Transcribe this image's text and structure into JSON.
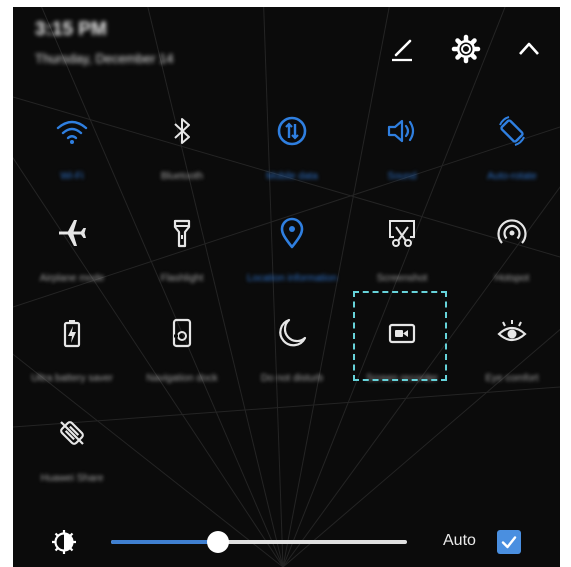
{
  "header": {
    "time": "3:15 PM",
    "date": "Thursday, December 14"
  },
  "tiles": [
    {
      "label": "Wi-Fi",
      "icon": "wifi-icon",
      "active": true
    },
    {
      "label": "Bluetooth",
      "icon": "bluetooth-icon",
      "active": false
    },
    {
      "label": "Mobile data",
      "icon": "mobile-data-icon",
      "active": true
    },
    {
      "label": "Sound",
      "icon": "sound-icon",
      "active": true
    },
    {
      "label": "Auto-rotate",
      "icon": "auto-rotate-icon",
      "active": true
    },
    {
      "label": "Airplane mode",
      "icon": "airplane-icon",
      "active": false
    },
    {
      "label": "Flashlight",
      "icon": "flashlight-icon",
      "active": false
    },
    {
      "label": "Location information",
      "icon": "location-icon",
      "active": true
    },
    {
      "label": "Screenshot",
      "icon": "screenshot-icon",
      "active": false
    },
    {
      "label": "Hotspot",
      "icon": "hotspot-icon",
      "active": false
    },
    {
      "label": "Ultra battery saver",
      "icon": "battery-saver-icon",
      "active": false
    },
    {
      "label": "Navigation dock",
      "icon": "navigation-dock-icon",
      "active": false
    },
    {
      "label": "Do not disturb",
      "icon": "moon-icon",
      "active": false
    },
    {
      "label": "Screen recorder",
      "icon": "screen-recorder-icon",
      "active": false
    },
    {
      "label": "Eye comfort",
      "icon": "eye-comfort-icon",
      "active": false
    },
    {
      "label": "Huawei Share",
      "icon": "share-icon",
      "active": false
    }
  ],
  "brightness": {
    "level_fraction": 0.36,
    "auto_label": "Auto",
    "auto_checked": true
  },
  "colors": {
    "accent": "#3f7fd0",
    "icon_active": "#2f7fe0",
    "icon_inactive": "#e6e6e6",
    "highlight": "#66d3da",
    "background": "#0b0b0b"
  }
}
